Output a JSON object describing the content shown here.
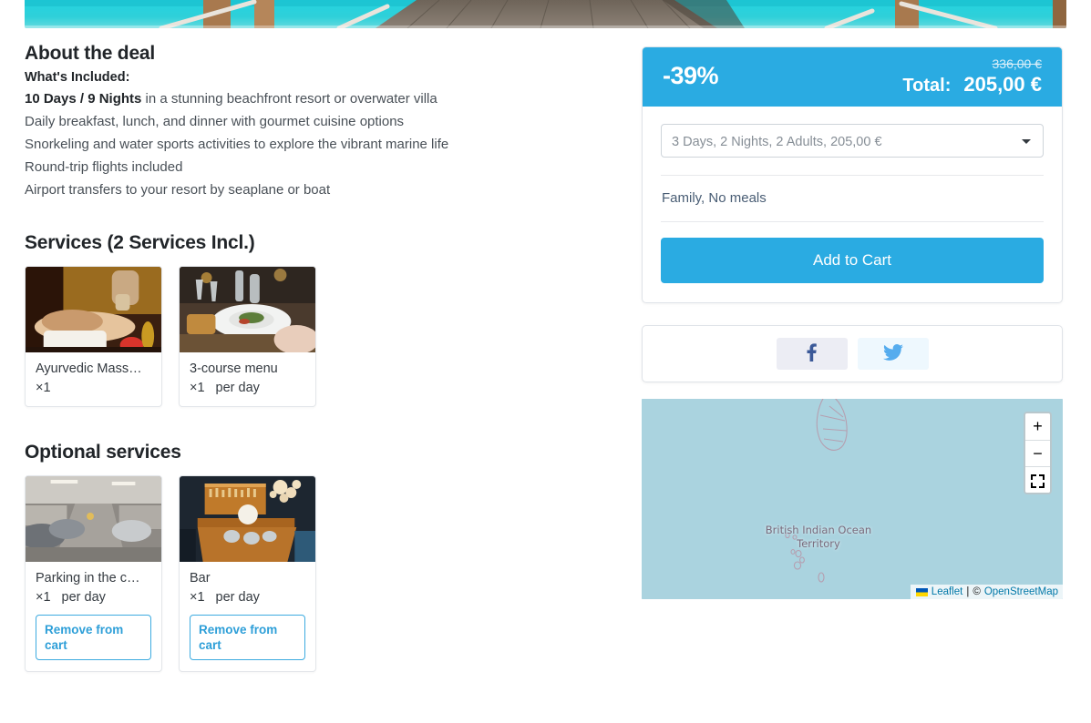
{
  "hero": {
    "alt": "beachfront-pier-turquoise-water"
  },
  "about": {
    "title": "About the deal",
    "included_label": "What's Included:",
    "lines": [
      {
        "bold": "10 Days / 9 Nights",
        "rest": " in a stunning beachfront resort or overwater villa"
      },
      {
        "bold": "",
        "rest": "Daily breakfast, lunch, and dinner with gourmet cuisine options"
      },
      {
        "bold": "",
        "rest": "Snorkeling and water sports activities to explore the vibrant marine life"
      },
      {
        "bold": "",
        "rest": "Round-trip flights included"
      },
      {
        "bold": "",
        "rest": "Airport transfers to your resort by seaplane or boat"
      }
    ]
  },
  "services": {
    "title": "Services (2 Services Incl.)",
    "items": [
      {
        "name": "Ayurvedic Mass…",
        "qty": "×1",
        "per": "",
        "image": "massage-photo"
      },
      {
        "name": "3-course menu",
        "qty": "×1",
        "per": "per day",
        "image": "restaurant-dish-photo"
      }
    ]
  },
  "optional_services": {
    "title": "Optional services",
    "remove_label": "Remove from cart",
    "items": [
      {
        "name": "Parking in the c…",
        "qty": "×1",
        "per": "per day",
        "image": "parking-garage-photo"
      },
      {
        "name": "Bar",
        "qty": "×1",
        "per": "per day",
        "image": "hotel-bar-photo"
      }
    ]
  },
  "pricing": {
    "discount": "-39%",
    "old_price": "336,00 €",
    "total_label": "Total:",
    "total_value": "205,00 €",
    "select_value": "3 Days, 2 Nights, 2 Adults, 205,00 €",
    "variant": "Family, No meals",
    "add_to_cart": "Add to Cart"
  },
  "social": {
    "facebook_label": "facebook-icon",
    "twitter_label": "twitter-icon"
  },
  "map": {
    "label": "British Indian Ocean Territory",
    "zoom_in": "+",
    "zoom_out": "−",
    "fullscreen": "fullscreen-icon",
    "attribution_leaflet": "Leaflet",
    "attribution_sep": "|",
    "attribution_copy": "©",
    "attribution_osm": "OpenStreetMap"
  },
  "colors": {
    "accent": "#2aabe2",
    "map_water": "#aad3df",
    "facebook": "#3b5998",
    "twitter": "#55acee"
  }
}
